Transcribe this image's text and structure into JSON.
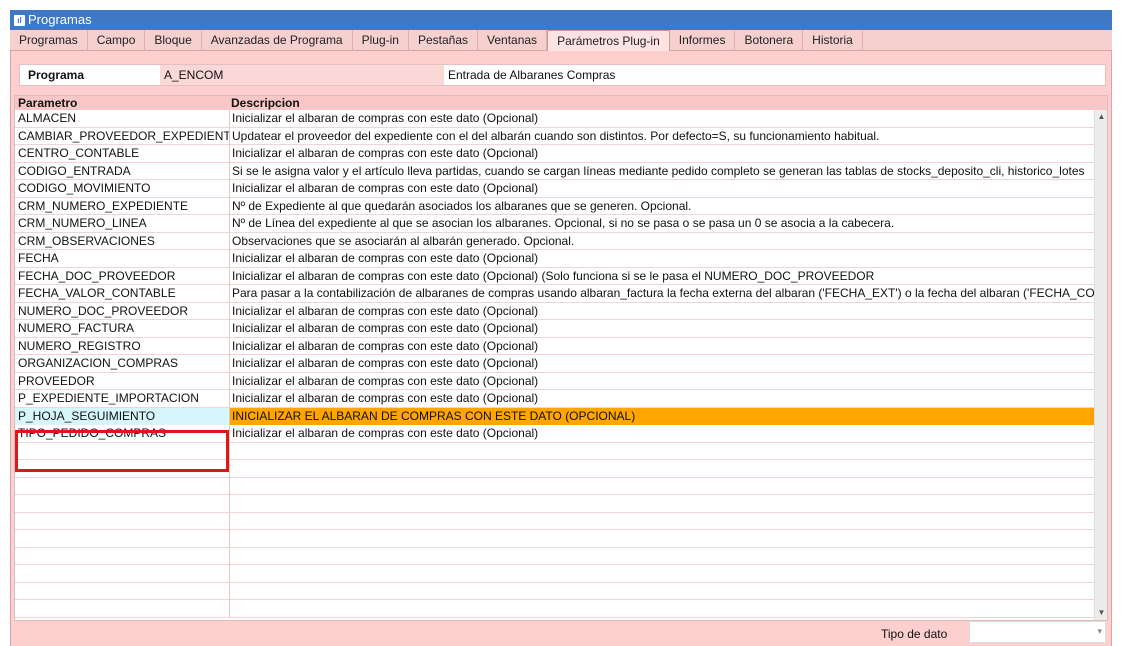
{
  "window": {
    "title": "Programas",
    "icon": "app-icon"
  },
  "tabs": [
    {
      "label": "Programas"
    },
    {
      "label": "Campo"
    },
    {
      "label": "Bloque"
    },
    {
      "label": "Avanzadas de Programa"
    },
    {
      "label": "Plug-in"
    },
    {
      "label": "Pestañas"
    },
    {
      "label": "Ventanas"
    },
    {
      "label": "Parámetros Plug-in",
      "active": true
    },
    {
      "label": "Informes"
    },
    {
      "label": "Botonera"
    },
    {
      "label": "Historia"
    }
  ],
  "programa": {
    "label": "Programa",
    "code": "A_ENCOM",
    "description": "Entrada de Albaranes Compras"
  },
  "grid": {
    "columns": [
      "Parametro",
      "Descripcion"
    ],
    "rows": [
      {
        "param": "ALMACEN",
        "desc": "Inicializar el albaran de compras con este dato (Opcional)"
      },
      {
        "param": "CAMBIAR_PROVEEDOR_EXPEDIENTE",
        "desc": "Updatear el proveedor del expediente con el del albarán cuando son distintos. Por defecto=S, su funcionamiento habitual."
      },
      {
        "param": "CENTRO_CONTABLE",
        "desc": "Inicializar el albaran de compras con este dato (Opcional)"
      },
      {
        "param": "CODIGO_ENTRADA",
        "desc": "Si se le asigna valor y el artículo lleva partidas, cuando se cargan líneas mediante pedido completo se generan las tablas de stocks_deposito_cli, historico_lotes"
      },
      {
        "param": "CODIGO_MOVIMIENTO",
        "desc": "Inicializar el albaran de compras con este dato (Opcional)"
      },
      {
        "param": "CRM_NUMERO_EXPEDIENTE",
        "desc": "Nº de Expediente al que quedarán asociados los albaranes que se generen. Opcional."
      },
      {
        "param": "CRM_NUMERO_LINEA",
        "desc": "Nº de Línea del expediente al que se asocian los albaranes. Opcional, si no se pasa o se pasa un 0 se asocia a la cabecera."
      },
      {
        "param": "CRM_OBSERVACIONES",
        "desc": "Observaciones que se asociarán al albarán generado. Opcional."
      },
      {
        "param": "FECHA",
        "desc": "Inicializar el albaran de compras con este dato (Opcional)"
      },
      {
        "param": "FECHA_DOC_PROVEEDOR",
        "desc": "Inicializar el albaran de compras con este dato (Opcional) (Solo funciona si se le pasa el NUMERO_DOC_PROVEEDOR"
      },
      {
        "param": "FECHA_VALOR_CONTABLE",
        "desc": "Para pasar a la contabilización de albaranes de compras usando albaran_factura la fecha externa del albaran ('FECHA_EXT') o la fecha del albaran ('FECHA_CO"
      },
      {
        "param": "NUMERO_DOC_PROVEEDOR",
        "desc": "Inicializar el albaran de compras con este dato (Opcional)"
      },
      {
        "param": "NUMERO_FACTURA",
        "desc": "Inicializar el albaran de compras con este dato (Opcional)"
      },
      {
        "param": "NUMERO_REGISTRO",
        "desc": "Inicializar el albaran de compras con este dato (Opcional)"
      },
      {
        "param": "ORGANIZACION_COMPRAS",
        "desc": "Inicializar el albaran de compras con este dato (Opcional)"
      },
      {
        "param": "PROVEEDOR",
        "desc": "Inicializar el albaran de compras con este dato (Opcional)"
      },
      {
        "param": "P_EXPEDIENTE_IMPORTACION",
        "desc": "Inicializar el albaran de compras con este dato (Opcional)"
      },
      {
        "param": "P_HOJA_SEGUIMIENTO",
        "desc": "INICIALIZAR EL ALBARAN DE COMPRAS CON ESTE DATO (OPCIONAL)",
        "selected": true
      },
      {
        "param": "TIPO_PEDIDO_COMPRAS",
        "desc": "Inicializar el albaran de compras con este dato (Opcional)"
      },
      {
        "param": "",
        "desc": ""
      },
      {
        "param": "",
        "desc": ""
      },
      {
        "param": "",
        "desc": ""
      },
      {
        "param": "",
        "desc": ""
      },
      {
        "param": "",
        "desc": ""
      },
      {
        "param": "",
        "desc": ""
      },
      {
        "param": "",
        "desc": ""
      },
      {
        "param": "",
        "desc": ""
      },
      {
        "param": "",
        "desc": ""
      },
      {
        "param": "",
        "desc": ""
      }
    ]
  },
  "footer": {
    "tipo_label": "Tipo de dato",
    "tipo_value": ""
  },
  "colors": {
    "titlebar": "#3f78c4",
    "panel": "#fdcfcf",
    "selected_desc": "#ffa500",
    "selected_param": "#d6f6fb",
    "highlight_box": "#e01616"
  }
}
